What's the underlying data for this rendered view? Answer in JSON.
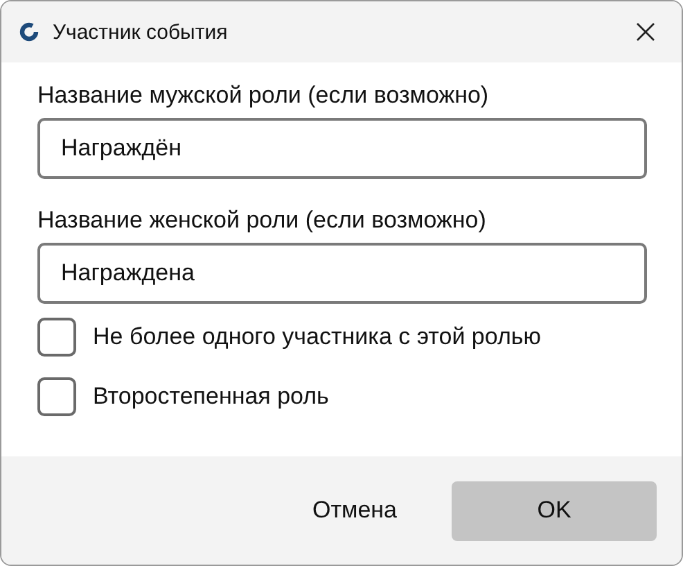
{
  "window": {
    "title": "Участник события"
  },
  "fields": [
    {
      "label": "Название мужской роли (если возможно)",
      "value": "Награждён"
    },
    {
      "label": "Название женской роли (если возможно)",
      "value": "Награждена"
    }
  ],
  "checkboxes": [
    {
      "label": "Не более одного участника с этой ролью",
      "checked": false
    },
    {
      "label": "Второстепенная роль",
      "checked": false
    }
  ],
  "buttons": [
    {
      "label": "Отмена",
      "kind": "flat"
    },
    {
      "label": "OK",
      "kind": "filled"
    }
  ]
}
